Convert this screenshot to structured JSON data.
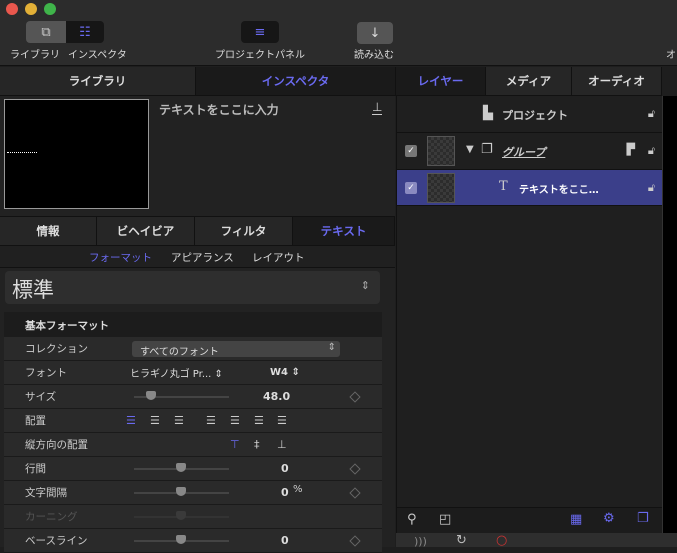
{
  "colors": {
    "accent": "#6a6af0",
    "selected_row": "#3b3f8a"
  },
  "toolbar": {
    "library": "ライブラリ",
    "inspector": "インスペクタ",
    "project_panel": "プロジェクトパネル",
    "import": "読み込む",
    "overflow": "オ"
  },
  "tabs": {
    "left": [
      "ライブラリ",
      "インスペクタ"
    ],
    "right": [
      "レイヤー",
      "メディア",
      "オーディオ"
    ]
  },
  "inspector": {
    "title": "テキストをここに入力",
    "tabs": [
      "情報",
      "ビヘイビア",
      "フィルタ",
      "テキスト"
    ],
    "subtabs": [
      "フォーマット",
      "アピアランス",
      "レイアウト"
    ],
    "preset": "標準",
    "section": "基本フォーマット",
    "collection_label": "コレクション",
    "collection_value": "すべてのフォント",
    "font_label": "フォント",
    "font_value": "ヒラギノ丸ゴ Pr...",
    "weight_value": "W4",
    "size_label": "サイズ",
    "size_value": "48.0",
    "align_label": "配置",
    "valign_label": "縦方向の配置",
    "line_spacing_label": "行間",
    "line_spacing_value": "0",
    "tracking_label": "文字間隔",
    "tracking_value": "0",
    "tracking_unit": "%",
    "kerning_label": "カーニング",
    "baseline_label": "ベースライン",
    "baseline_value": "0"
  },
  "layers": {
    "project": "プロジェクト",
    "group": "グループ",
    "text": "テキストをここ…"
  }
}
